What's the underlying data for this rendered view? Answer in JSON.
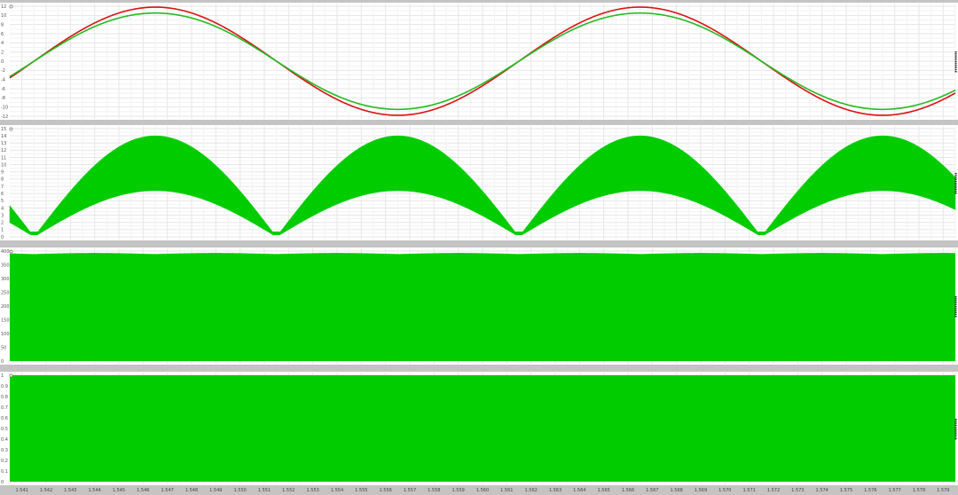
{
  "chart_data": [
    {
      "type": "line",
      "title": "",
      "ylim": [
        -12,
        12
      ],
      "yticks": [
        "12",
        "10",
        "8",
        "6",
        "4",
        "2",
        "0",
        "-2",
        "-4",
        "-6",
        "-8",
        "-10",
        "-12"
      ],
      "series": [
        {
          "color": "#dd1111",
          "amplitude": 11.8,
          "period": 0.02,
          "phase_deg": 0,
          "kind": "sine"
        },
        {
          "color": "#22bb22",
          "amplitude": 10.6,
          "period": 0.02,
          "phase_deg": 0,
          "kind": "sine"
        }
      ],
      "grid": true
    },
    {
      "type": "area",
      "title": "",
      "ylim": [
        0,
        15
      ],
      "yticks": [
        "15",
        "14",
        "13",
        "12",
        "11",
        "10",
        "9",
        "8",
        "7",
        "6",
        "5",
        "4",
        "3",
        "2",
        "1",
        "0"
      ],
      "series": [
        {
          "color": "#00cc00",
          "upper_peak": 14.0,
          "lower_peak": 6.4,
          "floor": 0.7,
          "period": 0.01,
          "kind": "rectified-band"
        }
      ],
      "grid": true
    },
    {
      "type": "area",
      "title": "",
      "ylim": [
        0,
        400
      ],
      "yticks": [
        "400",
        "350",
        "300",
        "250",
        "200",
        "150",
        "100",
        "50",
        "0"
      ],
      "series": [
        {
          "color": "#00cc00",
          "upper": 393,
          "ripple": 4,
          "lower": 0,
          "kind": "dense-band"
        }
      ],
      "grid": true
    },
    {
      "type": "area",
      "title": "",
      "ylim": [
        0,
        1
      ],
      "yticks": [
        "1",
        "0.9",
        "0.8",
        "0.7",
        "0.6",
        "0.5",
        "0.4",
        "0.3",
        "0.2",
        "0.1",
        "0"
      ],
      "series": [
        {
          "color": "#00cc00",
          "upper": 1,
          "lower": 0,
          "kind": "pwm-band"
        }
      ],
      "grid": true
    }
  ],
  "x_axis": {
    "xlim": [
      1.5405,
      1.5795
    ],
    "ticks": [
      "1.541",
      "1.542",
      "1.543",
      "1.544",
      "1.545",
      "1.546",
      "1.547",
      "1.548",
      "1.549",
      "1.550",
      "1.551",
      "1.552",
      "1.553",
      "1.554",
      "1.555",
      "1.556",
      "1.557",
      "1.558",
      "1.559",
      "1.560",
      "1.561",
      "1.562",
      "1.563",
      "1.564",
      "1.565",
      "1.566",
      "1.567",
      "1.568",
      "1.569",
      "1.570",
      "1.571",
      "1.572",
      "1.573",
      "1.574",
      "1.575",
      "1.576",
      "1.577",
      "1.578",
      "1.579"
    ]
  }
}
